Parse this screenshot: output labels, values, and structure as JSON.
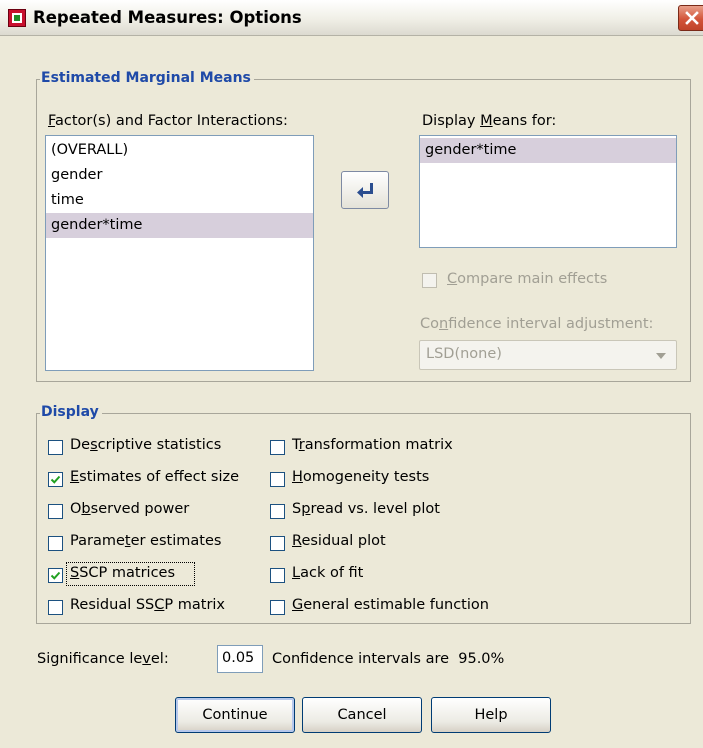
{
  "window": {
    "title": "Repeated Measures: Options"
  },
  "emm": {
    "legend": "Estimated Marginal Means",
    "factors_label": "Factor(s) and Factor Interactions:",
    "factors": [
      "(OVERALL)",
      "gender",
      "time",
      "gender*time"
    ],
    "selected_factor": "gender*time",
    "display_means_label": "Display Means for:",
    "display_means": [
      "gender*time"
    ],
    "compare_main_effects_label": "Compare main effects",
    "compare_main_effects_checked": false,
    "ci_adjustment_label": "Confidence interval adjustment:",
    "ci_adjustment_value": "LSD(none)"
  },
  "display": {
    "legend": "Display",
    "left": [
      {
        "label": "Descriptive statistics",
        "checked": false
      },
      {
        "label": "Estimates of effect size",
        "checked": true
      },
      {
        "label": "Observed power",
        "checked": false
      },
      {
        "label": "Parameter estimates",
        "checked": false
      },
      {
        "label": "SSCP matrices",
        "checked": true
      },
      {
        "label": "Residual SSCP matrix",
        "checked": false
      }
    ],
    "right": [
      {
        "label": "Transformation matrix",
        "checked": false
      },
      {
        "label": "Homogeneity tests",
        "checked": false
      },
      {
        "label": "Spread vs. level plot",
        "checked": false
      },
      {
        "label": "Residual plot",
        "checked": false
      },
      {
        "label": "Lack of fit",
        "checked": false
      },
      {
        "label": "General estimable function",
        "checked": false
      }
    ]
  },
  "significance": {
    "label": "Significance level:",
    "value": "0.05",
    "ci_text": "Confidence intervals are  95.0%"
  },
  "buttons": {
    "continue": "Continue",
    "cancel": "Cancel",
    "help": "Help"
  },
  "icons": {
    "app": "spss-dialog-icon",
    "close": "close-icon",
    "move": "move-arrow-icon",
    "dropdown": "chevron-down-icon"
  },
  "colors": {
    "legend": "#1f4aa8",
    "selection": "#d7cfdc",
    "dialog_bg": "#ece9d8"
  }
}
